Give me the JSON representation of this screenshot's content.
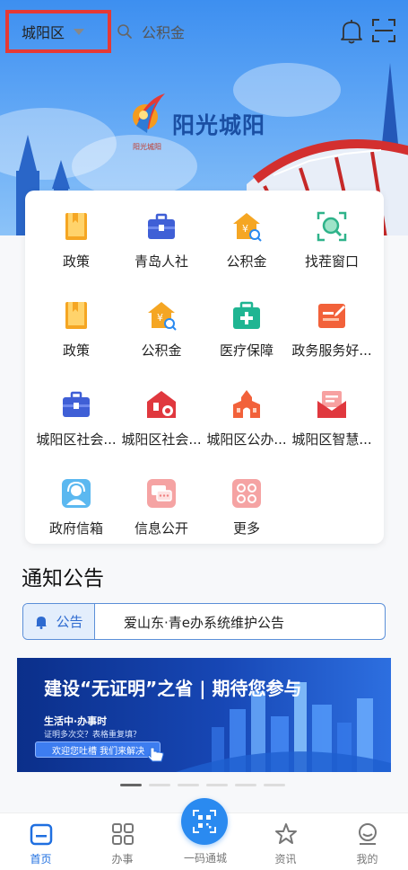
{
  "header": {
    "district": "城阳区",
    "search_placeholder": "公积金"
  },
  "brand": {
    "title": "阳光城阳",
    "subtitle": "阳光城阳"
  },
  "services": [
    {
      "label": "政策",
      "icon": "book-icon",
      "color": "#f5a623"
    },
    {
      "label": "青岛人社",
      "icon": "briefcase-icon",
      "color": "#3f5fd6"
    },
    {
      "label": "公积金",
      "icon": "housing-fund-icon",
      "color": "#f5a623"
    },
    {
      "label": "找茬窗口",
      "icon": "magnifier-frame-icon",
      "color": "#2fb38a"
    },
    {
      "label": "政策",
      "icon": "book-icon",
      "color": "#f5a623"
    },
    {
      "label": "公积金",
      "icon": "housing-fund-icon",
      "color": "#f5a623"
    },
    {
      "label": "医疗保障",
      "icon": "medical-kit-icon",
      "color": "#1fb592"
    },
    {
      "label": "政务服务好...",
      "icon": "edit-note-icon",
      "color": "#f2613a"
    },
    {
      "label": "城阳区社会...",
      "icon": "briefcase-icon",
      "color": "#3f5fd6"
    },
    {
      "label": "城阳区社会...",
      "icon": "house-badge-icon",
      "color": "#e0383e"
    },
    {
      "label": "城阳区公办...",
      "icon": "school-icon",
      "color": "#f2613a"
    },
    {
      "label": "城阳区智慧...",
      "icon": "mail-icon",
      "color": "#e0383e"
    },
    {
      "label": "政府信箱",
      "icon": "support-agent-icon",
      "color": "#5bb8f0"
    },
    {
      "label": "信息公开",
      "icon": "chat-bubbles-icon",
      "color": "#f08080"
    },
    {
      "label": "更多",
      "icon": "clover-grid-icon",
      "color": "#f08080"
    }
  ],
  "notice": {
    "section_title": "通知公告",
    "tag": "公告",
    "text": "爱山东·青e办系统维护公告"
  },
  "banner": {
    "headline": "建设“无证明”之省 | 期待您参与",
    "line1": "生活中·办事时",
    "line2": "证明多次交？表格重复填？",
    "button": "欢迎您吐槽 我们来解决"
  },
  "tabs": [
    {
      "label": "首页",
      "icon": "home-icon",
      "active": true
    },
    {
      "label": "办事",
      "icon": "grid-icon",
      "active": false
    },
    {
      "label": "一码通城",
      "icon": "qr-code-icon",
      "active": false
    },
    {
      "label": "资讯",
      "icon": "star-icon",
      "active": false
    },
    {
      "label": "我的",
      "icon": "profile-icon",
      "active": false
    }
  ],
  "colors": {
    "accent": "#1f6fe0",
    "highlight_border": "#e53935"
  }
}
